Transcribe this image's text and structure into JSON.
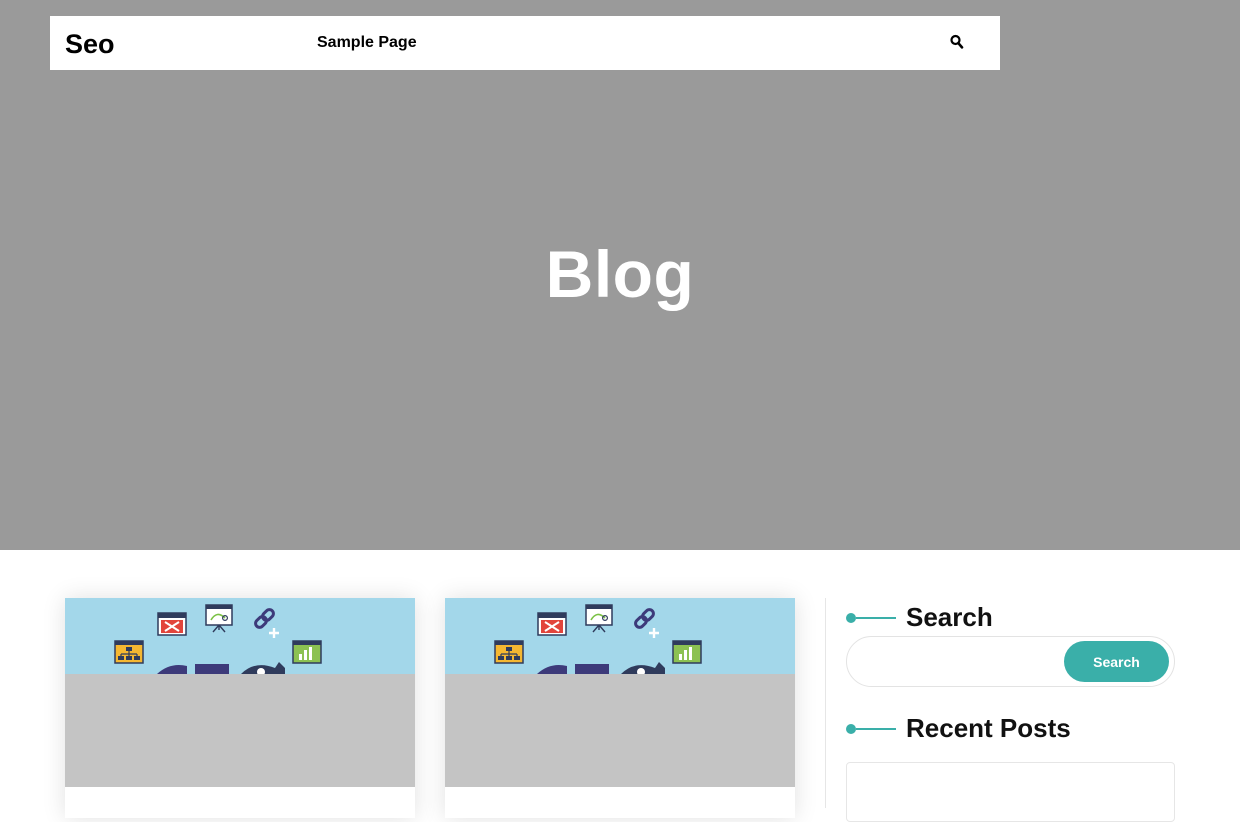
{
  "header": {
    "site_title": "Seo",
    "nav": [
      {
        "label": "Sample Page"
      }
    ],
    "search_icon": "search-icon"
  },
  "hero": {
    "title": "Blog",
    "background": "#9a9a9a"
  },
  "posts": [
    {
      "thumbnail": "seo-icons-illustration"
    },
    {
      "thumbnail": "seo-icons-illustration"
    }
  ],
  "sidebar": {
    "search_widget": {
      "title": "Search",
      "input_value": "",
      "button_label": "Search"
    },
    "recent_posts_widget": {
      "title": "Recent Posts"
    }
  },
  "colors": {
    "accent": "#3aafa9",
    "thumb_sky": "#a3d7ea",
    "thumb_placeholder": "#c4c4c4"
  }
}
